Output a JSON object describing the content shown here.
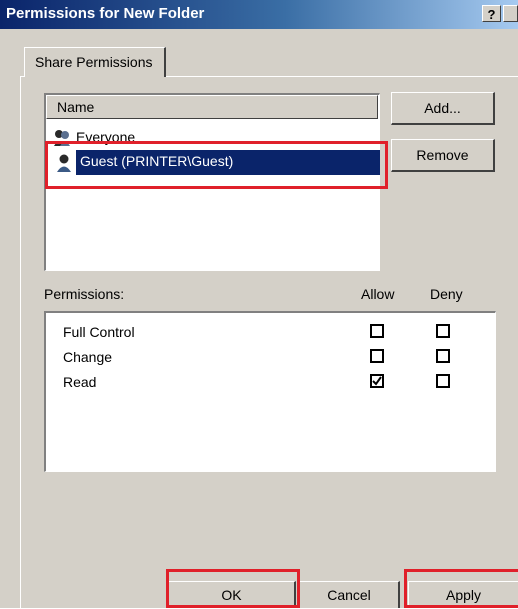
{
  "window": {
    "title": "Permissions for New Folder",
    "help_label": "?",
    "close_label": "X"
  },
  "tabs": [
    {
      "label": "Share Permissions",
      "active": true
    }
  ],
  "users_list": {
    "column_header": "Name",
    "items": [
      {
        "label": "Everyone",
        "icon": "group-users-icon",
        "selected": false
      },
      {
        "label": "Guest (PRINTER\\Guest)",
        "icon": "user-icon",
        "selected": true
      }
    ]
  },
  "buttons": {
    "add": "Add...",
    "remove": "Remove",
    "ok": "OK",
    "cancel": "Cancel",
    "apply": "Apply"
  },
  "permissions": {
    "label": "Permissions:",
    "allow_header": "Allow",
    "deny_header": "Deny",
    "rows": [
      {
        "name": "Full Control",
        "allow": false,
        "deny": false
      },
      {
        "name": "Change",
        "allow": false,
        "deny": false
      },
      {
        "name": "Read",
        "allow": true,
        "deny": false
      }
    ]
  },
  "colors": {
    "selection": "#0a246a",
    "highlight_box": "#e0202a",
    "dialog_bg": "#d4d0c8"
  }
}
